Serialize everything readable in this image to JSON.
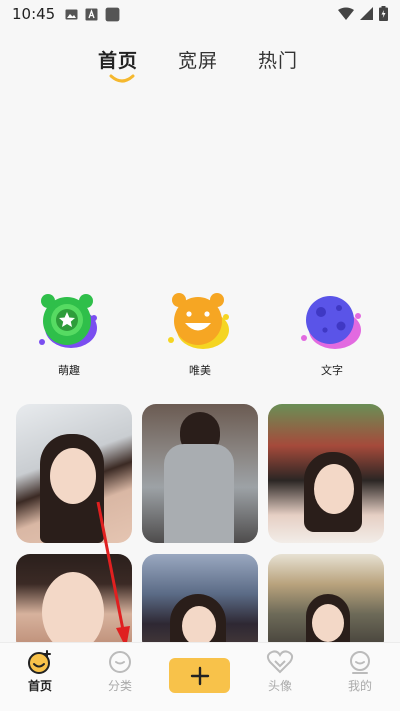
{
  "status_bar": {
    "time": "10:45",
    "left_icons": [
      "image-icon",
      "text-a-icon",
      "square-icon"
    ],
    "right_icons": [
      "wifi-icon",
      "signal-icon",
      "battery-icon"
    ]
  },
  "top_tabs": [
    {
      "label": "首页",
      "selected": true
    },
    {
      "label": "宽屏",
      "selected": false
    },
    {
      "label": "热门",
      "selected": false
    }
  ],
  "categories": [
    {
      "label": "萌趣",
      "icon": "green-cat-face-icon"
    },
    {
      "label": "唯美",
      "icon": "yellow-bear-face-icon"
    },
    {
      "label": "文字",
      "icon": "purple-moon-icon"
    }
  ],
  "bottom_nav": {
    "home": "首页",
    "category": "分类",
    "avatar": "头像",
    "mine": "我的",
    "add_icon": "plus-icon"
  },
  "colors": {
    "accent": "#f8c24a",
    "background": "#f7f7f7",
    "arrow": "#e02020"
  }
}
